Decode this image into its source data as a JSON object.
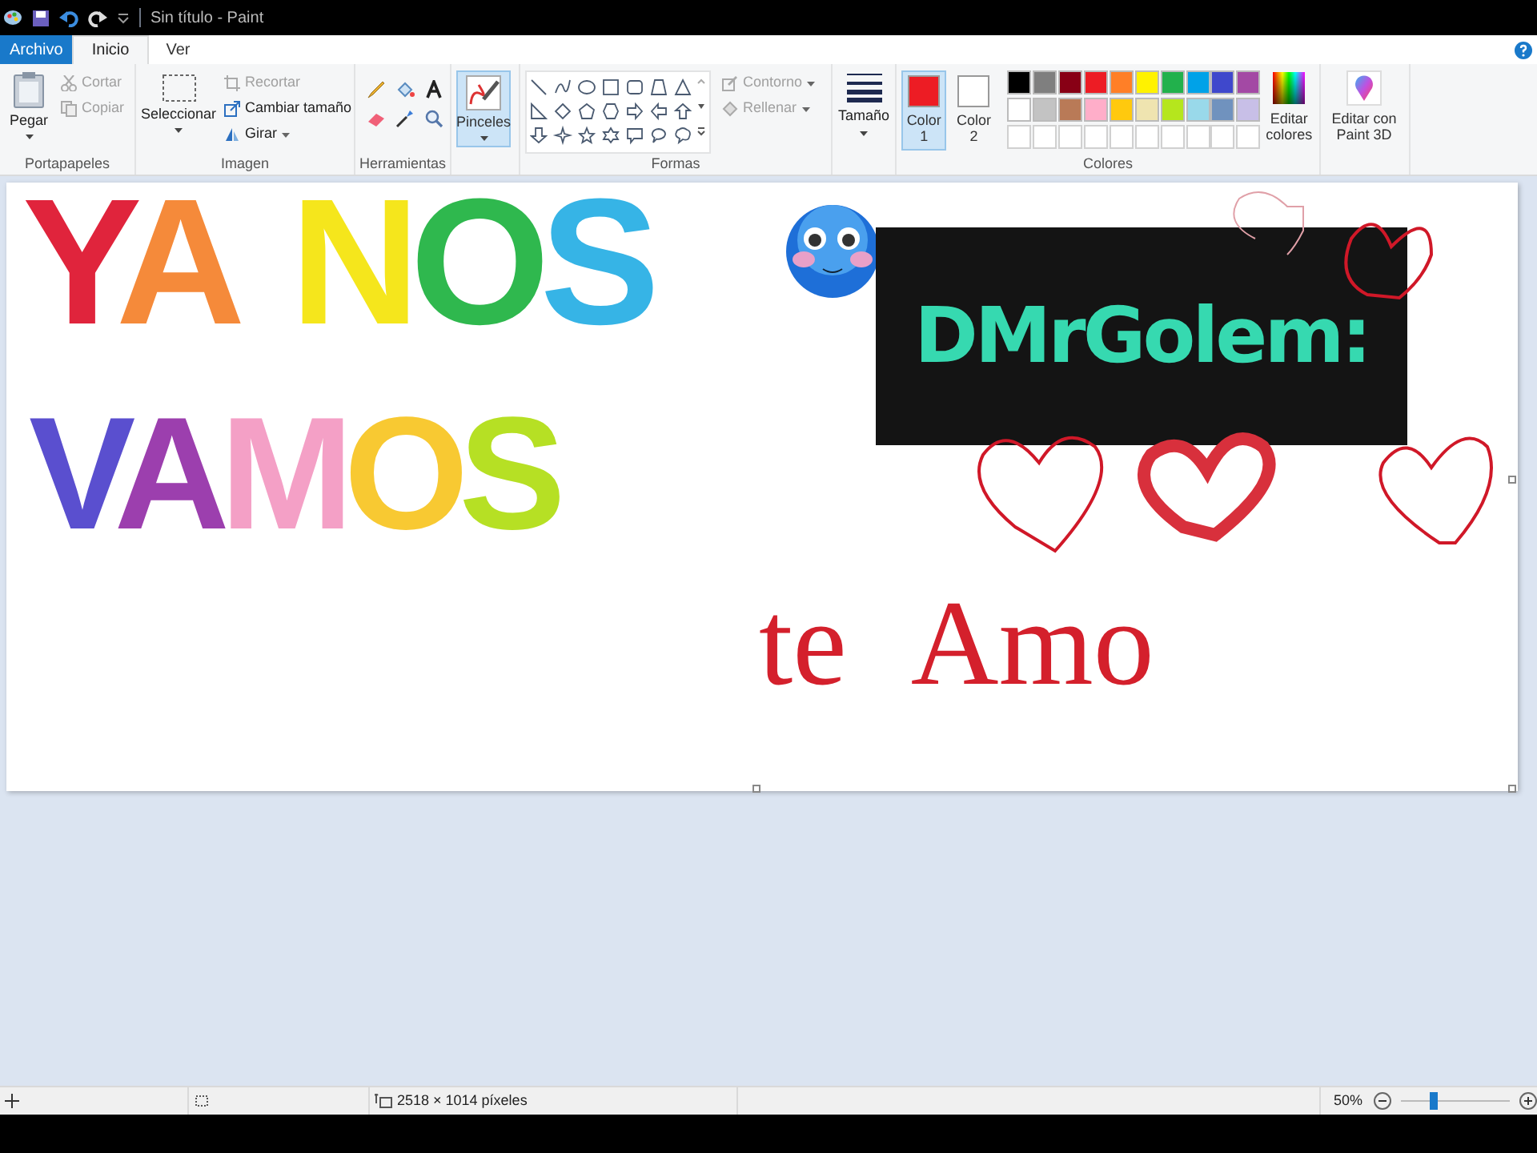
{
  "window": {
    "title": "Sin título - Paint"
  },
  "tabs": [
    {
      "label": "Archivo",
      "kind": "file",
      "selected": false
    },
    {
      "label": "Inicio",
      "kind": "tab",
      "selected": true
    },
    {
      "label": "Ver",
      "kind": "tab",
      "selected": false
    }
  ],
  "ribbon": {
    "clipboard": {
      "label": "Portapapeles",
      "paste": {
        "label": "Pegar"
      },
      "cut": {
        "label": "Cortar",
        "disabled": true
      },
      "copy": {
        "label": "Copiar",
        "disabled": true
      }
    },
    "image": {
      "label": "Imagen",
      "select": {
        "label": "Seleccionar"
      },
      "crop": {
        "label": "Recortar",
        "disabled": true
      },
      "resize": {
        "label": "Cambiar tamaño",
        "disabled": false
      },
      "rotate": {
        "label": "Girar"
      }
    },
    "tools": {
      "label": "Herramientas"
    },
    "brushes": {
      "label": "Pinceles",
      "selected": true
    },
    "shapes": {
      "label": "Formas",
      "outline": {
        "label": "Contorno",
        "disabled": true
      },
      "fill": {
        "label": "Rellenar",
        "disabled": true
      }
    },
    "size": {
      "label": "Tamaño"
    },
    "colors": {
      "label": "Colores",
      "slots": [
        {
          "label": "Color 1",
          "color": "#ed1c24",
          "selected": true
        },
        {
          "label": "Color 2",
          "color": "#ffffff",
          "selected": false
        }
      ],
      "palette": [
        {
          "color": "#000000"
        },
        {
          "color": "#7f7f7f"
        },
        {
          "color": "#880015"
        },
        {
          "color": "#ed1c24"
        },
        {
          "color": "#ff7f27"
        },
        {
          "color": "#fff200"
        },
        {
          "color": "#22b14c"
        },
        {
          "color": "#00a2e8"
        },
        {
          "color": "#3f48cc"
        },
        {
          "color": "#a349a4"
        },
        {
          "color": "#ffffff"
        },
        {
          "color": "#c3c3c3"
        },
        {
          "color": "#b97a57"
        },
        {
          "color": "#ffaec9"
        },
        {
          "color": "#ffc90e"
        },
        {
          "color": "#efe4b0"
        },
        {
          "color": "#b5e61d"
        },
        {
          "color": "#99d9ea"
        },
        {
          "color": "#7092be"
        },
        {
          "color": "#c8bfe7"
        }
      ],
      "edit": {
        "label": "Editar colores"
      }
    },
    "paint3d": {
      "label": "Editar con Paint 3D"
    }
  },
  "canvas": {
    "lines": [
      {
        "words": [
          {
            "letters": [
              {
                "char": "Y",
                "color": "#e0243c"
              },
              {
                "char": "A",
                "color": "#f58a3a"
              }
            ]
          },
          {
            "letters": [
              {
                "char": "N",
                "color": "#f5e61c"
              },
              {
                "char": "O",
                "color": "#2fb84e"
              },
              {
                "char": "S",
                "color": "#36b4e6"
              }
            ]
          }
        ]
      },
      {
        "words": [
          {
            "letters": [
              {
                "char": "V",
                "color": "#5a4fcf"
              },
              {
                "char": "A",
                "color": "#9c3fae"
              },
              {
                "char": "M",
                "color": "#f4a0c6"
              },
              {
                "char": "O",
                "color": "#f8c932"
              },
              {
                "char": "S",
                "color": "#b6e024"
              }
            ]
          }
        ]
      },
      {
        "words": [
          {
            "letters": [
              {
                "char": "t",
                "color": "#d4202c"
              },
              {
                "char": "e",
                "color": "#d4202c"
              }
            ]
          },
          {
            "letters": [
              {
                "char": "A",
                "color": "#d4202c"
              },
              {
                "char": "m",
                "color": "#d4202c"
              },
              {
                "char": "o",
                "color": "#d4202c"
              }
            ]
          }
        ]
      }
    ],
    "label_image": {
      "text": "DMrGolem:"
    }
  },
  "status_bar": {
    "dimensions": "2518 × 1014 píxeles",
    "zoom": "50%",
    "zoom_slider": {
      "level": 0.3
    }
  }
}
